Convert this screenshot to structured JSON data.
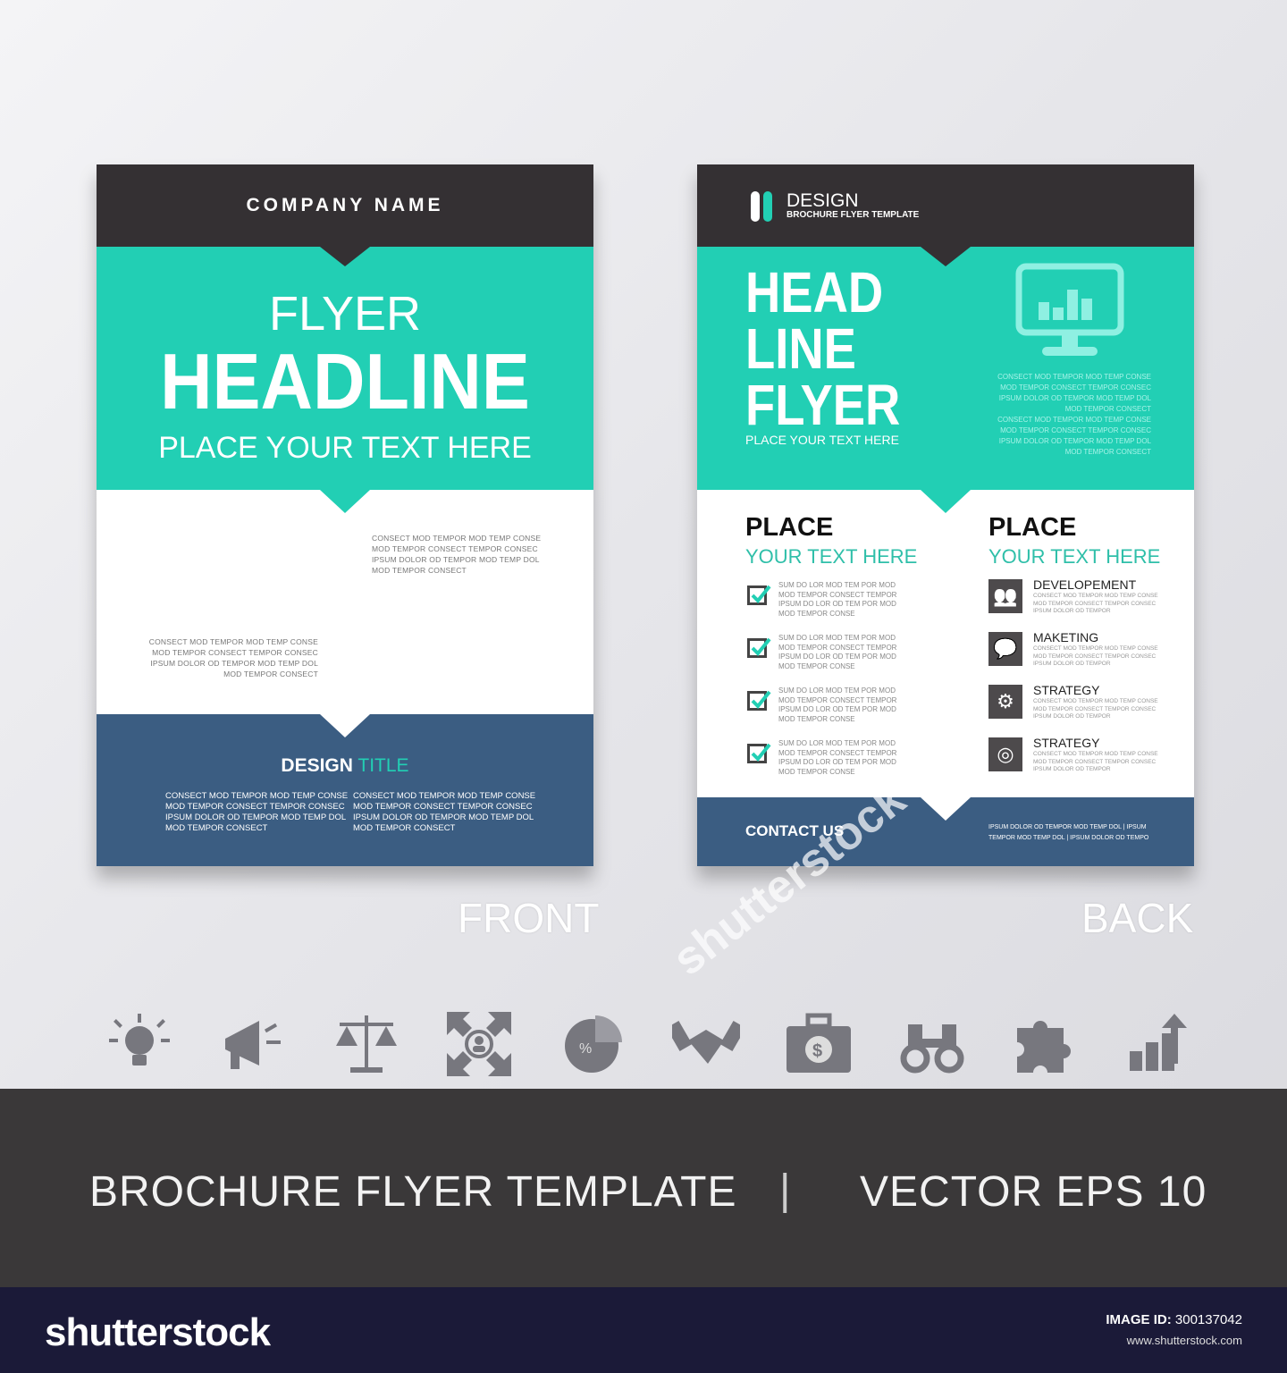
{
  "front": {
    "company_name": "COMPANY NAME",
    "flyer": "FLYER",
    "headline": "HEADLINE",
    "subtitle": "PLACE YOUR TEXT HERE",
    "text_block_right": [
      "CONSECT MOD TEMPOR MOD TEMP CONSE",
      "MOD TEMPOR  CONSECT TEMPOR  CONSEC",
      "IPSUM DOLOR OD TEMPOR MOD TEMP DOL",
      "MOD TEMPOR  CONSECT"
    ],
    "text_block_left": [
      "CONSECT MOD TEMPOR MOD TEMP CONSE",
      "MOD TEMPOR  CONSECT TEMPOR  CONSEC",
      "IPSUM DOLOR OD TEMPOR MOD TEMP DOL",
      "MOD TEMPOR  CONSECT"
    ],
    "design": "DESIGN",
    "title": "TITLE",
    "footer_col1": [
      "CONSECT MOD TEMPOR MOD TEMP CONSE",
      "MOD TEMPOR  CONSECT TEMPOR  CONSEC",
      "IPSUM DOLOR OD TEMPOR MOD TEMP DOL",
      "MOD TEMPOR  CONSECT"
    ],
    "footer_col2": [
      "CONSECT MOD TEMPOR MOD TEMP CONSE",
      "MOD TEMPOR  CONSECT TEMPOR  CONSEC",
      "IPSUM DOLOR OD TEMPOR MOD TEMP DOL",
      "MOD TEMPOR  CONSECT"
    ],
    "label": "FRONT"
  },
  "back": {
    "logo_title": "DESIGN",
    "logo_subtitle": "BROCHURE FLYER TEMPLATE",
    "headline": [
      "HEAD",
      "LINE",
      "FLYER"
    ],
    "subtitle": "PLACE YOUR TEXT HERE",
    "teal_text": [
      "CONSECT MOD TEMPOR MOD TEMP CONSE",
      "MOD TEMPOR  CONSECT TEMPOR  CONSEC",
      "IPSUM DOLOR OD TEMPOR MOD TEMP DOL",
      "MOD TEMPOR  CONSECT",
      "CONSECT MOD TEMPOR MOD TEMP CONSE",
      "MOD TEMPOR  CONSECT TEMPOR  CONSEC",
      "IPSUM DOLOR OD TEMPOR MOD TEMP DOL",
      "MOD TEMPOR  CONSECT"
    ],
    "left_heading": "PLACE",
    "left_sub": "YOUR TEXT HERE",
    "right_heading": "PLACE",
    "right_sub": "YOUR TEXT HERE",
    "checklist": [
      [
        "SUM DO LOR MOD TEM  POR MOD",
        "MOD TEMPOR  CONSECT TEMPOR",
        "IPSUM DO LOR OD TEM  POR MOD",
        "MOD TEMPOR  CONSE"
      ],
      [
        "SUM DO LOR MOD TEM  POR MOD",
        "MOD TEMPOR  CONSECT TEMPOR",
        "IPSUM DO LOR OD TEM  POR MOD",
        "MOD TEMPOR  CONSE"
      ],
      [
        "SUM DO LOR MOD TEM  POR MOD",
        "MOD TEMPOR  CONSECT TEMPOR",
        "IPSUM DO LOR OD TEM  POR MOD",
        "MOD TEMPOR  CONSE"
      ],
      [
        "SUM DO LOR MOD TEM  POR MOD",
        "MOD TEMPOR  CONSECT TEMPOR",
        "IPSUM DO LOR OD TEM  POR MOD",
        "MOD TEMPOR  CONSE"
      ]
    ],
    "features": [
      {
        "icon": "users-icon",
        "title": "DEVELOPEMENT",
        "text": [
          "CONSECT MOD TEMPOR MOD TEMP CONSE",
          "MOD TEMPOR  CONSECT TEMPOR  CONSEC",
          "IPSUM DOLOR OD TEMPOR"
        ]
      },
      {
        "icon": "chat-icon",
        "title": "MAKETING",
        "text": [
          "CONSECT MOD TEMPOR MOD TEMP CONSE",
          "MOD TEMPOR  CONSECT TEMPOR  CONSEC",
          "IPSUM DOLOR OD TEMPOR"
        ]
      },
      {
        "icon": "gears-icon",
        "title": "STRATEGY",
        "text": [
          "CONSECT MOD TEMPOR MOD TEMP CONSE",
          "MOD TEMPOR  CONSECT TEMPOR  CONSEC",
          "IPSUM DOLOR OD TEMPOR"
        ]
      },
      {
        "icon": "target-icon",
        "title": "STRATEGY",
        "text": [
          "CONSECT MOD TEMPOR MOD TEMP CONSE",
          "MOD TEMPOR  CONSECT TEMPOR  CONSEC",
          "IPSUM DOLOR OD TEMPOR"
        ]
      }
    ],
    "contact": "CONTACT US",
    "contact_text": [
      "IPSUM DOLOR OD TEMPOR MOD TEMP DOL  |  IPSUM",
      "TEMPOR MOD TEMP DOL  |  IPSUM DOLOR OD TEMPO"
    ],
    "label": "BACK"
  },
  "icons": [
    "lightbulb-icon",
    "megaphone-icon",
    "scales-icon",
    "user-target-icon",
    "pie-chart-icon",
    "handshake-icon",
    "money-briefcase-icon",
    "binoculars-icon",
    "puzzle-icon",
    "growth-chart-icon"
  ],
  "banner": {
    "left": "BROCHURE FLYER TEMPLATE",
    "separator": "|",
    "right": "VECTOR EPS 10"
  },
  "footer": {
    "logo": "shutterstock",
    "image_id_label": "IMAGE ID:",
    "image_id": "300137042",
    "url": "www.shutterstock.com"
  },
  "watermark": "shutterstock",
  "colors": {
    "teal": "#22cfb4",
    "navy": "#3b5d82",
    "dark": "#343033",
    "banner": "#3a3839",
    "footer": "#1b1a38"
  }
}
